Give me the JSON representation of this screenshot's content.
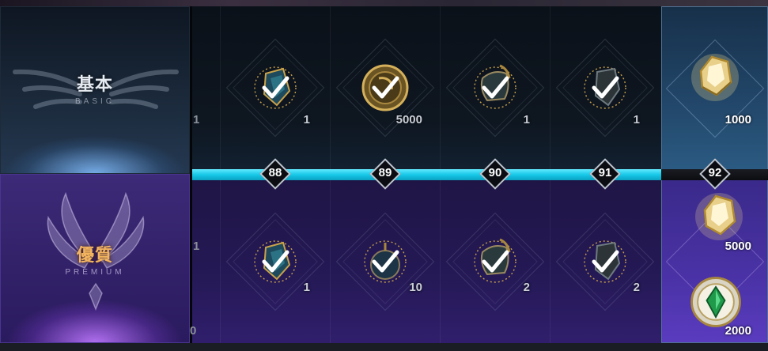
{
  "tiers": {
    "basic": {
      "label": "基本",
      "sub": "BASIC"
    },
    "premium": {
      "label": "優質",
      "sub": "PREMIUM"
    }
  },
  "levels": [
    "88",
    "89",
    "90",
    "91",
    "92"
  ],
  "partial_column": {
    "basic_qty": "1",
    "premium_qty": "1",
    "premium_qty_low": "0"
  },
  "basic_rewards": [
    {
      "icon": "crystal-shard-icon",
      "qty": "1",
      "claimed": true
    },
    {
      "icon": "gold-coin-icon",
      "qty": "5000",
      "claimed": true
    },
    {
      "icon": "dragon-armor-icon",
      "qty": "1",
      "claimed": true
    },
    {
      "icon": "dark-shard-icon",
      "qty": "1",
      "claimed": true
    },
    {
      "icon": "gold-crystal-icon",
      "qty": "1000",
      "claimed": false
    }
  ],
  "premium_rewards": [
    {
      "icon": "crystal-shard-icon",
      "qty": "1",
      "claimed": true
    },
    {
      "icon": "pendant-icon",
      "qty": "10",
      "claimed": true
    },
    {
      "icon": "dragon-armor-icon",
      "qty": "2",
      "claimed": true
    },
    {
      "icon": "dark-shard-icon",
      "qty": "2",
      "claimed": true
    },
    {
      "icon": "gold-crystal-icon",
      "qty": "5000",
      "claimed": false
    },
    {
      "icon": "emerald-medal-icon",
      "qty": "2000",
      "claimed": false
    }
  ],
  "colors": {
    "track": "#17c8e8",
    "basic_bg": "#1c2b3d",
    "premium_bg": "#33226a",
    "premium_label": "#f2b45f"
  }
}
